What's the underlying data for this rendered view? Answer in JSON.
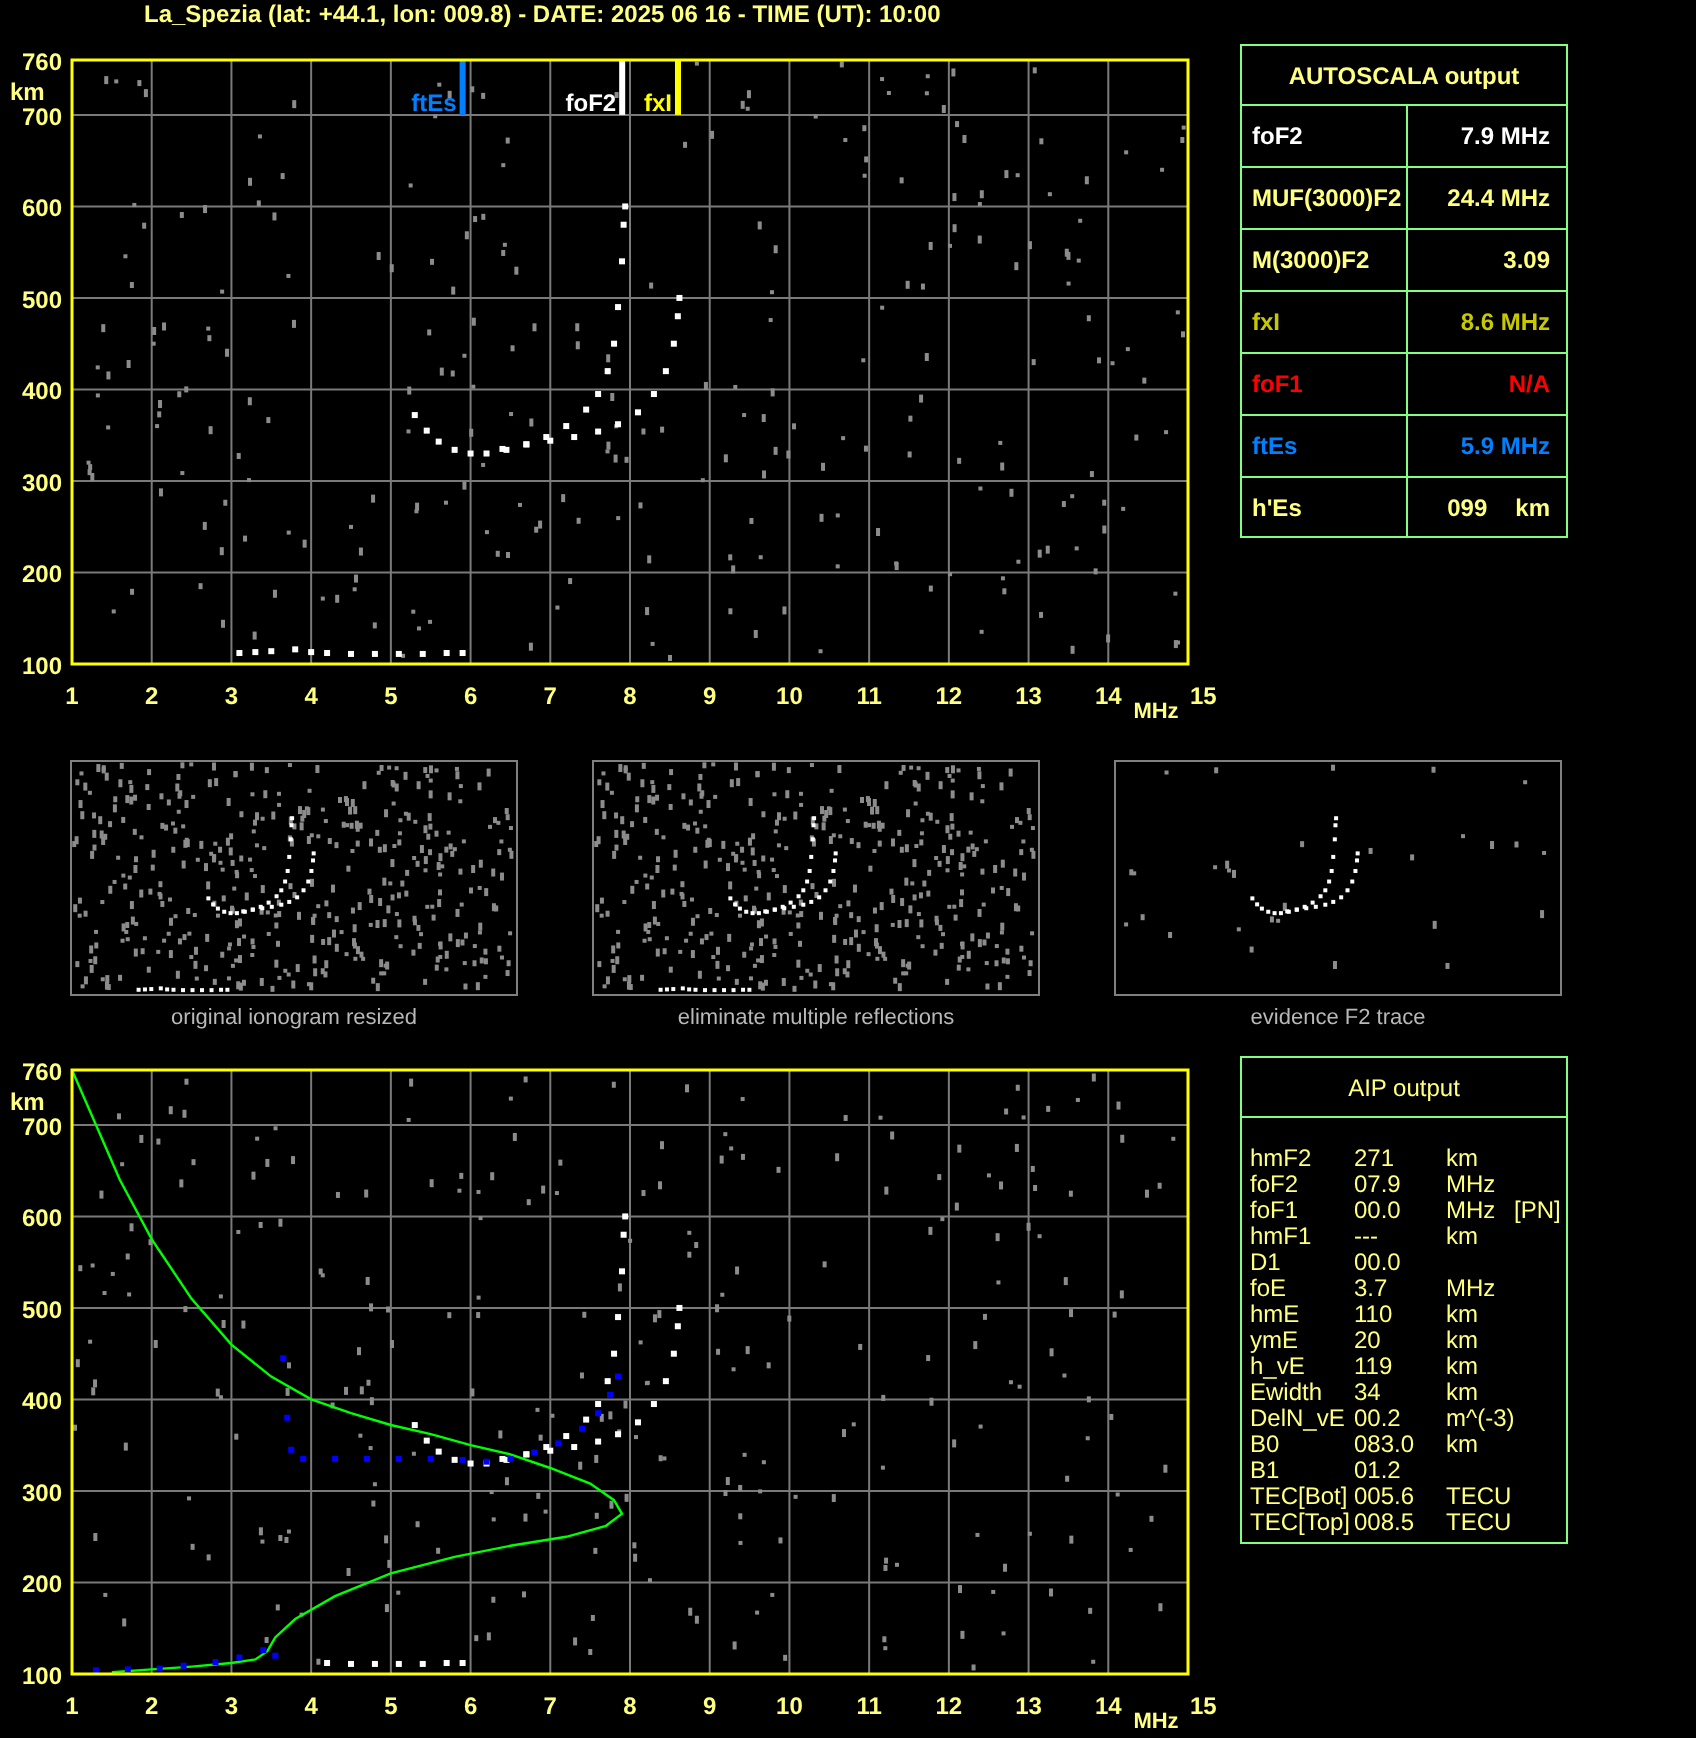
{
  "title": "La_Spezia (lat: +44.1, lon: 009.8) - DATE: 2025 06 16 - TIME (UT): 10:00",
  "top_chart": {
    "y_axis": {
      "unit": "km",
      "ticks": [
        "760",
        "700",
        "600",
        "500",
        "400",
        "300",
        "200",
        "100"
      ]
    },
    "x_axis": {
      "unit": "MHz",
      "ticks": [
        "1",
        "2",
        "3",
        "4",
        "5",
        "6",
        "7",
        "8",
        "9",
        "10",
        "11",
        "12",
        "13",
        "14",
        "15"
      ]
    },
    "markers": [
      {
        "label": "ftEs",
        "color": "#0080ff",
        "level": 0.35
      },
      {
        "label": "foF2",
        "color": "#ffffff",
        "level": 0.493
      },
      {
        "label": "fxI",
        "color": "#ffff00",
        "level": 0.543
      }
    ]
  },
  "autoscala": {
    "title": "AUTOSCALA output",
    "rows": [
      {
        "label": "foF2",
        "value": "7.9 MHz",
        "color": "#ffffff"
      },
      {
        "label": "MUF(3000)F2",
        "value": "24.4 MHz",
        "color": "#ffff80"
      },
      {
        "label": "M(3000)F2",
        "value": "3.09",
        "color": "#ffff80"
      },
      {
        "label": "fxI",
        "value": "8.6 MHz",
        "color": "#c8c800"
      },
      {
        "label": "foF1",
        "value": "N/A",
        "color": "#ff0000"
      },
      {
        "label": "ftEs",
        "value": "5.9 MHz",
        "color": "#0080ff"
      },
      {
        "label": "h'Es",
        "value": "099",
        "unit": "km",
        "color": "#ffff80"
      }
    ]
  },
  "thumbnails": [
    {
      "caption": "original ionogram resized",
      "kind": "full"
    },
    {
      "caption": "eliminate multiple reflections",
      "kind": "full"
    },
    {
      "caption": "evidence F2 trace",
      "kind": "trace_only"
    }
  ],
  "bottom_chart": {
    "y_axis": {
      "unit": "km",
      "ticks": [
        "760",
        "700",
        "600",
        "500",
        "400",
        "300",
        "200",
        "100"
      ]
    },
    "x_axis": {
      "unit": "MHz",
      "ticks": [
        "1",
        "2",
        "3",
        "4",
        "5",
        "6",
        "7",
        "8",
        "9",
        "10",
        "11",
        "12",
        "13",
        "14",
        "15"
      ]
    }
  },
  "aip": {
    "title": "AIP output",
    "rows": [
      {
        "name": "hmF2",
        "value": "271",
        "unit": "km"
      },
      {
        "name": "foF2",
        "value": "07.9",
        "unit": "MHz"
      },
      {
        "name": "foF1",
        "value": "00.0",
        "unit": "MHz",
        "note": "[PN]"
      },
      {
        "name": "hmF1",
        "value": "---",
        "unit": "km"
      },
      {
        "name": "D1",
        "value": "00.0"
      },
      {
        "name": "foE",
        "value": "3.7",
        "unit": "MHz"
      },
      {
        "name": "hmE",
        "value": "110",
        "unit": "km"
      },
      {
        "name": "ymE",
        "value": "20",
        "unit": "km"
      },
      {
        "name": "h_vE",
        "value": "119",
        "unit": "km"
      },
      {
        "name": "Ewidth",
        "value": "34",
        "unit": "km"
      },
      {
        "name": "DelN_vE",
        "value": "00.2",
        "unit": "m^(-3)"
      },
      {
        "name": "B0",
        "value": "083.0",
        "unit": "km"
      },
      {
        "name": "B1",
        "value": "01.2"
      },
      {
        "name": "TEC[Bot]",
        "value": "005.6",
        "unit": "TECU"
      },
      {
        "name": "TEC[Top]",
        "value": "008.5",
        "unit": "TECU"
      }
    ]
  }
}
